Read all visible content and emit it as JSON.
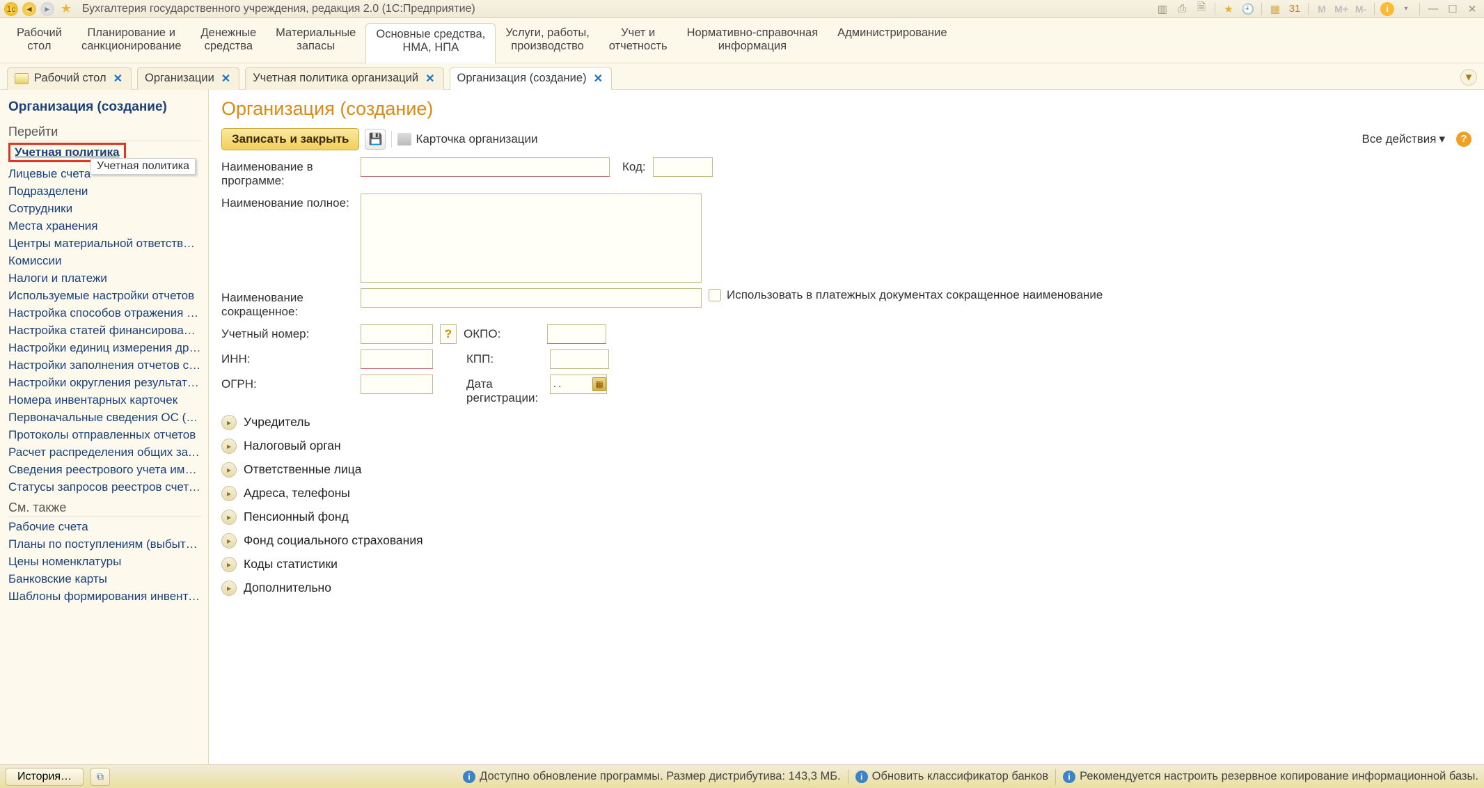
{
  "titlebar": {
    "title": "Бухгалтерия государственного учреждения, редакция 2.0  (1С:Предприятие)",
    "m_labels": [
      "M",
      "M+",
      "M-"
    ]
  },
  "mainnav": [
    "Рабочий\nстол",
    "Планирование и\nсанкционирование",
    "Денежные\nсредства",
    "Материальные\nзапасы",
    "Основные средства,\nНМА, НПА",
    "Услуги, работы,\nпроизводство",
    "Учет и\nотчетность",
    "Нормативно-справочная\nинформация",
    "Администрирование"
  ],
  "mainnav_active_index": 4,
  "doctabs": [
    {
      "label": "Рабочий стол",
      "desktop": true
    },
    {
      "label": "Организации"
    },
    {
      "label": "Учетная политика организаций"
    },
    {
      "label": "Организация (создание)",
      "active": true
    }
  ],
  "sidebar": {
    "title": "Организация (создание)",
    "section1": "Перейти",
    "highlight": "Учетная политика",
    "tooltip": "Учетная политика",
    "links1": [
      "Лицевые счета",
      "Подразделени",
      "Сотрудники",
      "Места хранения",
      "Центры материальной ответственности",
      "Комиссии",
      "Налоги и платежи",
      "Используемые настройки отчетов",
      "Настройка способов отражения зарплаты в …",
      "Настройка статей финансирования (зарплата)",
      "Настройки единиц измерения драг. материа…",
      "Настройки заполнения отчетов статистики …",
      "Настройки округления результата расчета н…",
      "Номера инвентарных карточек",
      "Первоначальные сведения ОС (бухгалтерск…",
      "Протоколы отправленных отчетов",
      "Расчет распределения общих затрат",
      "Сведения реестрового учета имущества",
      "Статусы запросов реестров счетов-фактур"
    ],
    "section2": "См. также",
    "links2": [
      "Рабочие счета",
      "Планы по поступлениям (выбытиям) органи…",
      "Цены номенклатуры",
      "Банковские карты",
      "Шаблоны формирования инвентарных номе…"
    ]
  },
  "form": {
    "title": "Организация (создание)",
    "write_close": "Записать и закрыть",
    "print_card": "Карточка организации",
    "all_actions": "Все действия",
    "labels": {
      "name_prog": "Наименование в программе:",
      "code": "Код:",
      "name_full": "Наименование полное:",
      "name_short": "Наименование сокращенное:",
      "use_short_check": "Использовать в платежных документах сокращенное наименование",
      "acc_no": "Учетный номер:",
      "okpo": "ОКПО:",
      "inn": "ИНН:",
      "kpp": "КПП:",
      "ogrn": "ОГРН:",
      "reg_date": "Дата регистрации:"
    },
    "values": {
      "name_prog": "",
      "code": "",
      "name_full": "",
      "name_short": "",
      "acc_no": "",
      "okpo": "",
      "inn": "",
      "kpp": "",
      "ogrn": "",
      "reg_date": ". ."
    },
    "expanders": [
      "Учредитель",
      "Налоговый орган",
      "Ответственные лица",
      "Адреса, телефоны",
      "Пенсионный фонд",
      "Фонд социального страхования",
      "Коды статистики",
      "Дополнительно"
    ]
  },
  "bottombar": {
    "history": "История…",
    "update_info": "Доступно обновление программы. Размер дистрибутива: 143,3 МБ.",
    "refresh_bank": "Обновить классификатор банков",
    "backup_hint": "Рекомендуется настроить резервное копирование информационной базы."
  }
}
